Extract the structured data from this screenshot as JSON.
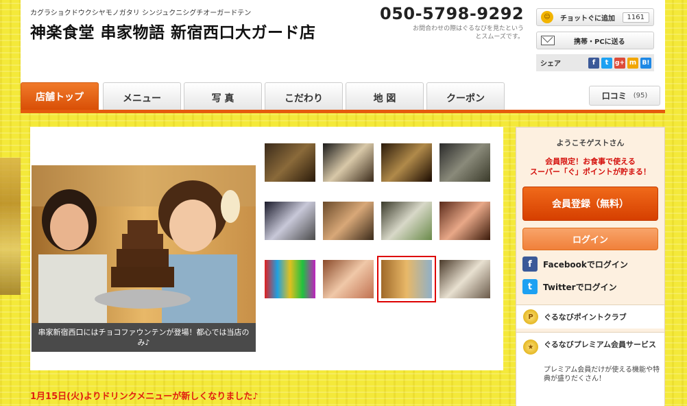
{
  "header": {
    "kana": "カグラショクドウクシヤモノガタリ シンジュクニシグチオーガードテン",
    "shop_name": "神楽食堂 串家物語 新宿西口大ガード店",
    "phone": "050-5798-9292",
    "phone_note": "お問合わせの際はぐるなびを見たというとスムーズです。",
    "fav_label": "チョットぐに追加",
    "fav_count": "1161",
    "send_label": "携帯・PCに送る",
    "share_label": "シェア"
  },
  "nav": {
    "tabs": [
      {
        "label": "店舗トップ",
        "active": true
      },
      {
        "label": "メニュー",
        "active": false
      },
      {
        "label": "写 真",
        "active": false
      },
      {
        "label": "こだわり",
        "active": false
      },
      {
        "label": "地 図",
        "active": false
      },
      {
        "label": "クーポン",
        "active": false
      }
    ],
    "review_label": "口コミ",
    "review_count": "(95)"
  },
  "gallery": {
    "caption": "串家新宿西口にはチョコファウンテンが登場！都心では当店のみ♪",
    "selected_thumb": 10
  },
  "sidebar": {
    "welcome": "ようこそゲストさん",
    "promo_line1": "会員限定！お食事で使える",
    "promo_line2": "スーパー「ぐ」ポイントが貯まる！",
    "register_label": "会員登録（無料）",
    "login_label": "ログイン",
    "facebook_label": "Facebookでログイン",
    "twitter_label": "Twitterでログイン",
    "point_club": "ぐるなびポイントクラブ",
    "premium_title": "ぐるなびプレミアム会員サービス",
    "premium_desc": "プレミアム会員だけが使える機能や特典が盛りだくさん！"
  },
  "notice": "1月15日(火)よりドリンクメニューが新しくなりました♪",
  "colors": {
    "accent_orange": "#e55a0e",
    "promo_red": "#d4100c",
    "background_yellow": "#f4e93a"
  }
}
